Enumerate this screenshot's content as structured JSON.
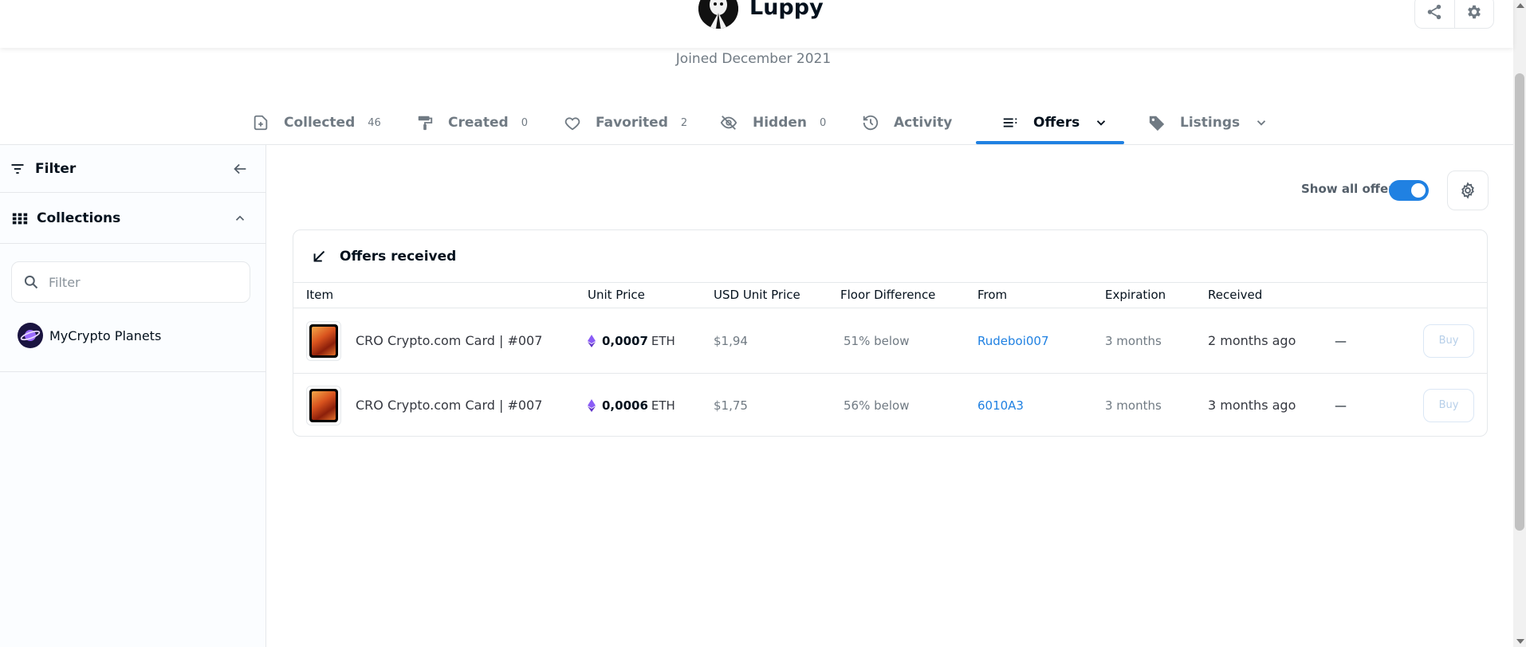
{
  "profile": {
    "username": "Luppy",
    "joined": "Joined December 2021"
  },
  "tabs": [
    {
      "label": "Collected",
      "count": "46"
    },
    {
      "label": "Created",
      "count": "0"
    },
    {
      "label": "Favorited",
      "count": "2"
    },
    {
      "label": "Hidden",
      "count": "0"
    },
    {
      "label": "Activity"
    },
    {
      "label": "Offers",
      "active": true
    },
    {
      "label": "Listings"
    }
  ],
  "sidebar": {
    "filter_label": "Filter",
    "collections_label": "Collections",
    "search_placeholder": "Filter",
    "collections": [
      {
        "name": "MyCrypto Planets"
      }
    ]
  },
  "controls": {
    "show_all_offers_label": "Show all offers",
    "show_all_offers_on": true
  },
  "offers": {
    "title": "Offers received",
    "columns": [
      "Item",
      "Unit Price",
      "USD Unit Price",
      "Floor Difference",
      "From",
      "Expiration",
      "Received"
    ],
    "rows": [
      {
        "item": "CRO Crypto.com Card | #007",
        "price": "0,0007",
        "currency": "ETH",
        "usd": "$1,94",
        "floor_diff": "51% below",
        "from": "Rudeboi007",
        "expiration": "3 months",
        "received": "2 months ago",
        "extra": "—",
        "action": "Buy"
      },
      {
        "item": "CRO Crypto.com Card | #007",
        "price": "0,0006",
        "currency": "ETH",
        "usd": "$1,75",
        "floor_diff": "56% below",
        "from": "6010A3",
        "expiration": "3 months",
        "received": "3 months ago",
        "extra": "—",
        "action": "Buy"
      }
    ]
  },
  "colors": {
    "accent": "#2081e2",
    "text": "#04111d",
    "muted": "#707a83",
    "border": "#e5e8eb"
  }
}
